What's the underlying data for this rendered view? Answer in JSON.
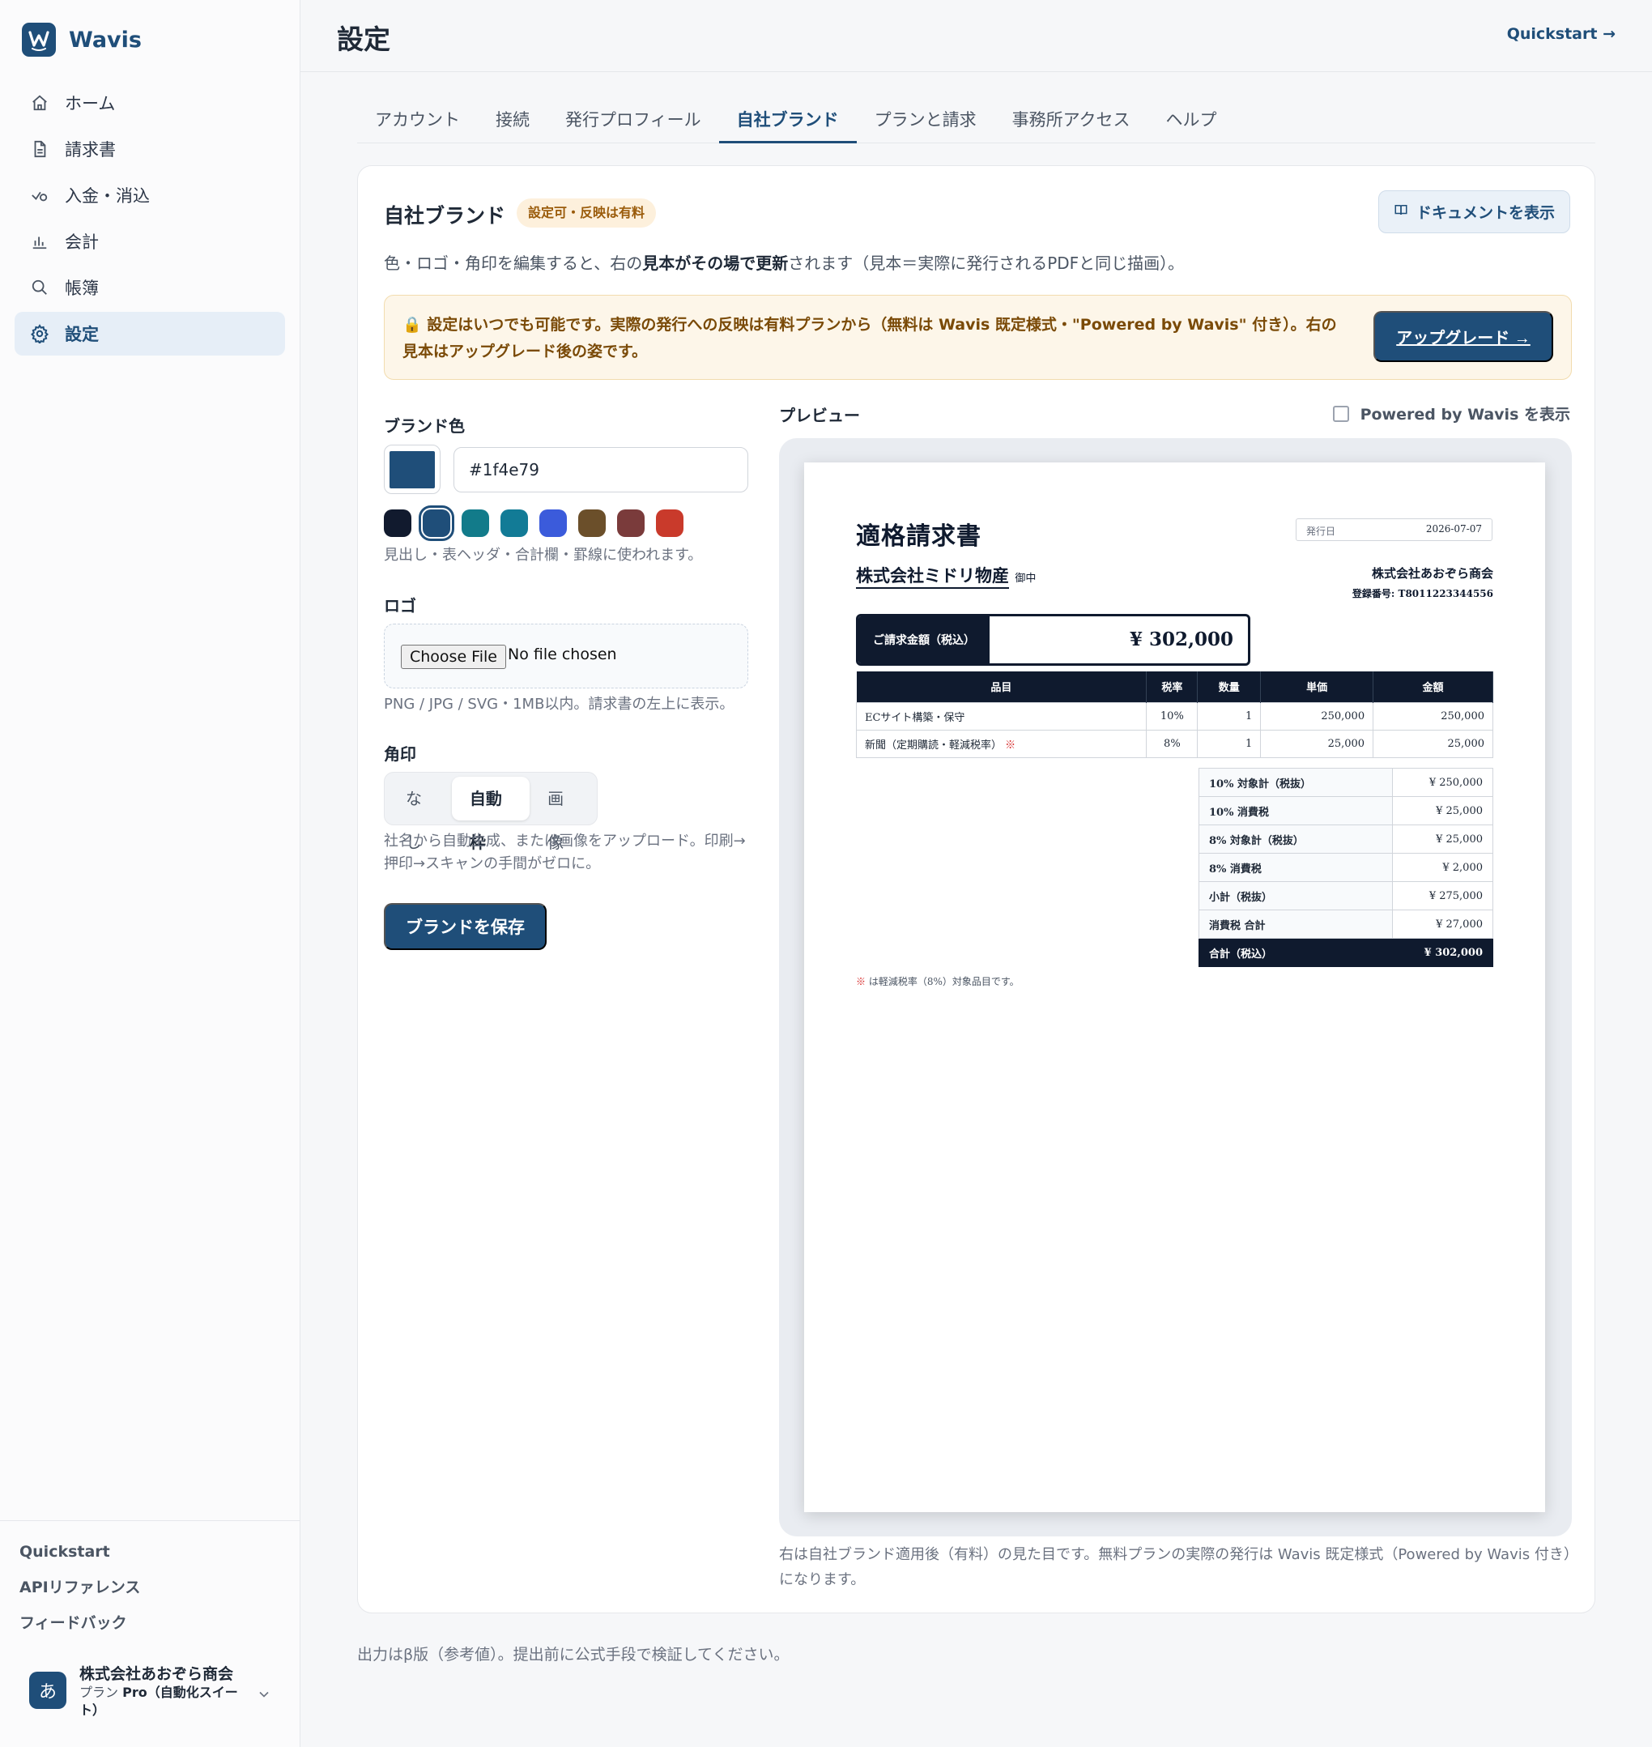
{
  "app": {
    "name": "Wavis"
  },
  "sidebar": {
    "items": [
      {
        "label": "ホーム",
        "icon": "home-icon"
      },
      {
        "label": "請求書",
        "icon": "document-icon"
      },
      {
        "label": "入金・消込",
        "icon": "payment-check-icon"
      },
      {
        "label": "会計",
        "icon": "bar-chart-icon"
      },
      {
        "label": "帳簿",
        "icon": "search-icon"
      },
      {
        "label": "設定",
        "icon": "gear-icon",
        "active": true
      }
    ],
    "links": [
      "Quickstart",
      "APIリファレンス",
      "フィードバック"
    ],
    "account": {
      "initial": "あ",
      "name": "株式会社あおぞら商会",
      "plan_prefix": "プラン",
      "plan_name": "Pro（自動化スイート）"
    }
  },
  "header": {
    "title": "設定",
    "quickstart": "Quickstart →"
  },
  "tabs": [
    "アカウント",
    "接続",
    "発行プロフィール",
    "自社ブランド",
    "プランと請求",
    "事務所アクセス",
    "ヘルプ"
  ],
  "active_tab": "自社ブランド",
  "card": {
    "title": "自社ブランド",
    "pill": "設定可・反映は有料",
    "doc_button": "ドキュメントを表示",
    "desc_pre": "色・ロゴ・角印を編集すると、右の",
    "desc_bold": "見本がその場で更新",
    "desc_post": "されます（見本＝実際に発行されるPDFと同じ描画）。",
    "notice": "🔒 設定はいつでも可能です。実際の発行への反映は有料プランから（無料は Wavis 既定様式・\"Powered by Wavis\" 付き）。右の見本はアップグレード後の姿です。",
    "upgrade_button": "アップグレード →"
  },
  "form": {
    "brand_color_label": "ブランド色",
    "brand_color_value": "#1f4e79",
    "swatches": [
      "#111a2e",
      "#1f4e79",
      "#127b8a",
      "#127b96",
      "#3b5bdb",
      "#6b4f2a",
      "#7a3b3b",
      "#c93a2b"
    ],
    "brand_color_help": "見出し・表ヘッダ・合計欄・罫線に使われます。",
    "logo_label": "ロゴ",
    "file_button": "Choose File",
    "file_none": "No file chosen",
    "logo_help": "PNG / JPG / SVG・1MB以内。請求書の左上に表示。",
    "seal_label": "角印",
    "seal_options": [
      "なし",
      "自動枠",
      "画像"
    ],
    "seal_selected": "自動枠",
    "seal_help": "社名から自動生成、または画像をアップロード。印刷→押印→スキャンの手間がゼロに。",
    "save_button": "ブランドを保存"
  },
  "preview": {
    "label": "プレビュー",
    "powered_toggle": "Powered by Wavis を表示",
    "note": "右は自社ブランド適用後（有料）の見た目です。無料プランの実際の発行は Wavis 既定様式（Powered by Wavis 付き）になります。"
  },
  "invoice": {
    "title": "適格請求書",
    "date_label": "発行日",
    "date_value": "2026-07-07",
    "client": "株式会社ミドリ物産",
    "client_suffix": "御中",
    "issuer": "株式会社あおぞら商会",
    "reg_no": "登録番号: T8011223344556",
    "amount_label": "ご請求金額（税込）",
    "amount_value": "¥ 302,000",
    "columns": [
      "品目",
      "税率",
      "数量",
      "単価",
      "金額"
    ],
    "rows": [
      {
        "item": "ECサイト構築・保守",
        "mark": "",
        "rate": "10%",
        "qty": "1",
        "unit": "250,000",
        "amount": "250,000"
      },
      {
        "item": "新聞（定期購読・軽減税率）",
        "mark": "※",
        "rate": "8%",
        "qty": "1",
        "unit": "25,000",
        "amount": "25,000"
      }
    ],
    "totals": [
      {
        "k": "10% 対象計（税抜）",
        "v": "¥ 250,000"
      },
      {
        "k": "10% 消費税",
        "v": "¥ 25,000"
      },
      {
        "k": "8% 対象計（税抜）",
        "v": "¥ 25,000"
      },
      {
        "k": "8% 消費税",
        "v": "¥ 2,000"
      },
      {
        "k": "小計（税抜）",
        "v": "¥ 275,000"
      },
      {
        "k": "消費税 合計",
        "v": "¥ 27,000"
      },
      {
        "k": "合計（税込）",
        "v": "¥ 302,000",
        "grand": true
      }
    ],
    "footnote_mark": "※",
    "footnote": " は軽減税率（8%）対象品目です。"
  },
  "footer": "出力はβ版（参考値）。提出前に公式手段で検証してください。"
}
